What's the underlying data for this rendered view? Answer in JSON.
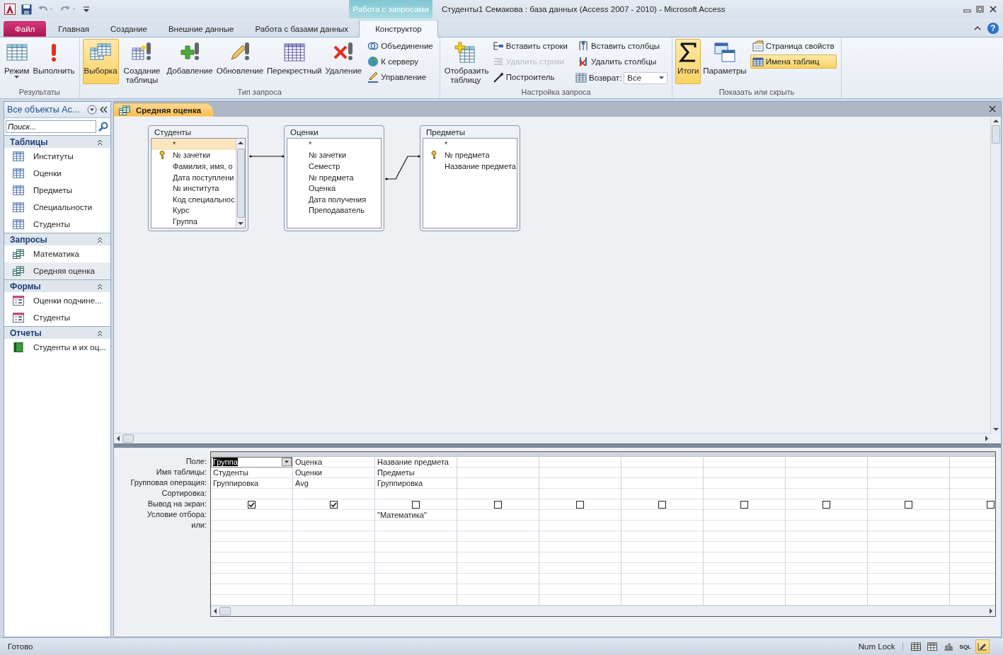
{
  "window": {
    "title": "Студенты1 Семакова : база данных (Access 2007 - 2010)  -  Microsoft Access",
    "context_tab": "Работа с запросами",
    "help": "?"
  },
  "ribbon_tabs": [
    {
      "label": "Файл",
      "kind": "file",
      "selected": false
    },
    {
      "label": "Главная",
      "kind": "tab",
      "selected": false
    },
    {
      "label": "Создание",
      "kind": "tab",
      "selected": false
    },
    {
      "label": "Внешние данные",
      "kind": "tab",
      "selected": false
    },
    {
      "label": "Работа с базами данных",
      "kind": "tab",
      "selected": false
    },
    {
      "label": "Конструктор",
      "kind": "tab",
      "selected": true
    }
  ],
  "ribbon_groups": [
    {
      "title": "Результаты",
      "large": [
        {
          "label": "Режим",
          "selected": false,
          "dropdown": true
        },
        {
          "label": "Выполнить",
          "selected": false,
          "dropdown": false
        }
      ]
    },
    {
      "title": "Тип запроса",
      "large": [
        {
          "label": "Выборка",
          "selected": true,
          "dropdown": false
        },
        {
          "label": "Создание таблицы",
          "selected": false,
          "dropdown": false
        },
        {
          "label": "Добавление",
          "selected": false,
          "dropdown": false
        },
        {
          "label": "Обновление",
          "selected": false,
          "dropdown": false
        },
        {
          "label": "Перекрестный",
          "selected": false,
          "dropdown": false
        },
        {
          "label": "Удаление",
          "selected": false,
          "dropdown": false
        }
      ],
      "small": [
        {
          "kind": "button",
          "label": "Объединение",
          "disabled": false,
          "selected": false
        },
        {
          "kind": "button",
          "label": "К серверу",
          "disabled": false,
          "selected": false
        },
        {
          "kind": "button",
          "label": "Управление",
          "disabled": false,
          "selected": false
        }
      ]
    },
    {
      "title": "Настройка запроса",
      "large": [
        {
          "label": "Отобразить таблицу",
          "selected": false,
          "dropdown": false
        }
      ],
      "small": [
        {
          "kind": "button",
          "label": "Вставить строки",
          "disabled": false,
          "selected": false
        },
        {
          "kind": "button",
          "label": "Удалить строки",
          "disabled": true,
          "selected": false
        },
        {
          "kind": "button",
          "label": "Построитель",
          "disabled": false,
          "selected": false
        },
        {
          "kind": "button",
          "label": "Вставить столбцы",
          "disabled": false,
          "selected": false
        },
        {
          "kind": "button",
          "label": "Удалить столбцы",
          "disabled": false,
          "selected": false
        },
        {
          "kind": "dropdown",
          "label": "Возврат:",
          "value": "Все",
          "disabled": false,
          "selected": false
        }
      ]
    },
    {
      "title": "Показать или скрыть",
      "large": [
        {
          "label": "Итоги",
          "selected": true,
          "dropdown": false
        },
        {
          "label": "Параметры",
          "selected": false,
          "dropdown": false
        }
      ],
      "small": [
        {
          "kind": "button",
          "label": "Страница свойств",
          "disabled": false,
          "selected": false
        },
        {
          "kind": "button",
          "label": "Имена таблиц",
          "disabled": false,
          "selected": true
        }
      ]
    }
  ],
  "nav_pane": {
    "title": "Все объекты Ac...",
    "search": {
      "placeholder": "Поиск..."
    },
    "sections": [
      {
        "title": "Таблицы",
        "kind": "tables",
        "expanded": true,
        "items": [
          {
            "label": "Институты",
            "selected": false
          },
          {
            "label": "Оценки",
            "selected": false
          },
          {
            "label": "Предметы",
            "selected": false
          },
          {
            "label": "Специальности",
            "selected": false
          },
          {
            "label": "Студенты",
            "selected": false
          }
        ]
      },
      {
        "title": "Запросы",
        "kind": "queries",
        "expanded": true,
        "items": [
          {
            "label": "Математика",
            "selected": false
          },
          {
            "label": "Средняя оценка",
            "selected": true
          }
        ]
      },
      {
        "title": "Формы",
        "kind": "forms",
        "expanded": true,
        "items": [
          {
            "label": "Оценки подчине...",
            "selected": false
          },
          {
            "label": "Студенты",
            "selected": false
          }
        ]
      },
      {
        "title": "Отчеты",
        "kind": "reports",
        "expanded": true,
        "items": [
          {
            "label": "Студенты и их оц...",
            "selected": false
          }
        ]
      }
    ]
  },
  "document_tabs": [
    {
      "label": "Средняя оценка",
      "selected": true
    }
  ],
  "diagram_tables": [
    {
      "title": "Студенты",
      "scrollable": true,
      "fields": [
        {
          "label": "*",
          "key": false,
          "selected": true
        },
        {
          "label": "№ зачетки",
          "key": true,
          "selected": false
        },
        {
          "label": "Фамилия, имя, о",
          "key": false,
          "selected": false
        },
        {
          "label": "Дата поступлени",
          "key": false,
          "selected": false
        },
        {
          "label": "№ института",
          "key": false,
          "selected": false
        },
        {
          "label": "Код специальнос",
          "key": false,
          "selected": false
        },
        {
          "label": "Курс",
          "key": false,
          "selected": false
        },
        {
          "label": "Группа",
          "key": false,
          "selected": false
        }
      ]
    },
    {
      "title": "Оценки",
      "scrollable": false,
      "fields": [
        {
          "label": "*",
          "key": false,
          "selected": false
        },
        {
          "label": "№ зачетки",
          "key": false,
          "selected": false
        },
        {
          "label": "Семестр",
          "key": false,
          "selected": false
        },
        {
          "label": "№ предмета",
          "key": false,
          "selected": false
        },
        {
          "label": "Оценка",
          "key": false,
          "selected": false
        },
        {
          "label": "Дата получения",
          "key": false,
          "selected": false
        },
        {
          "label": "Преподаватель",
          "key": false,
          "selected": false
        }
      ]
    },
    {
      "title": "Предметы",
      "scrollable": false,
      "fields": [
        {
          "label": "*",
          "key": false,
          "selected": false
        },
        {
          "label": "№ предмета",
          "key": true,
          "selected": false
        },
        {
          "label": "Название предмета",
          "key": false,
          "selected": false
        }
      ]
    }
  ],
  "design_grid": {
    "row_labels": [
      "Поле:",
      "Имя таблицы:",
      "Групповая операция:",
      "Сортировка:",
      "Вывод на экран:",
      "Условие отбора:",
      "или:"
    ],
    "columns": [
      {
        "field": "Группа",
        "table": "Студенты",
        "total": "Группировка",
        "show": true,
        "selected": true
      },
      {
        "field": "Оценка",
        "table": "Оценки",
        "total": "Avg",
        "show": true,
        "selected": false
      },
      {
        "field": "Название предмета",
        "table": "Предметы",
        "total": "Группировка",
        "show": false,
        "criteria": "\"Математика\"",
        "selected": false
      },
      {
        "show": false,
        "selected": false
      },
      {
        "show": false,
        "selected": false
      },
      {
        "show": false,
        "selected": false
      },
      {
        "show": false,
        "selected": false
      },
      {
        "show": false,
        "selected": false
      },
      {
        "show": false,
        "selected": false
      },
      {
        "show": false,
        "selected": false
      }
    ]
  },
  "status_bar": {
    "text": "Готово",
    "num_lock": "Num Lock",
    "views": [
      {
        "kind": "datasheet",
        "selected": false
      },
      {
        "kind": "pivottable",
        "selected": false
      },
      {
        "kind": "pivotchart",
        "selected": false
      },
      {
        "kind": "sql",
        "label": "SQL",
        "selected": false
      },
      {
        "kind": "design",
        "selected": true
      }
    ]
  }
}
